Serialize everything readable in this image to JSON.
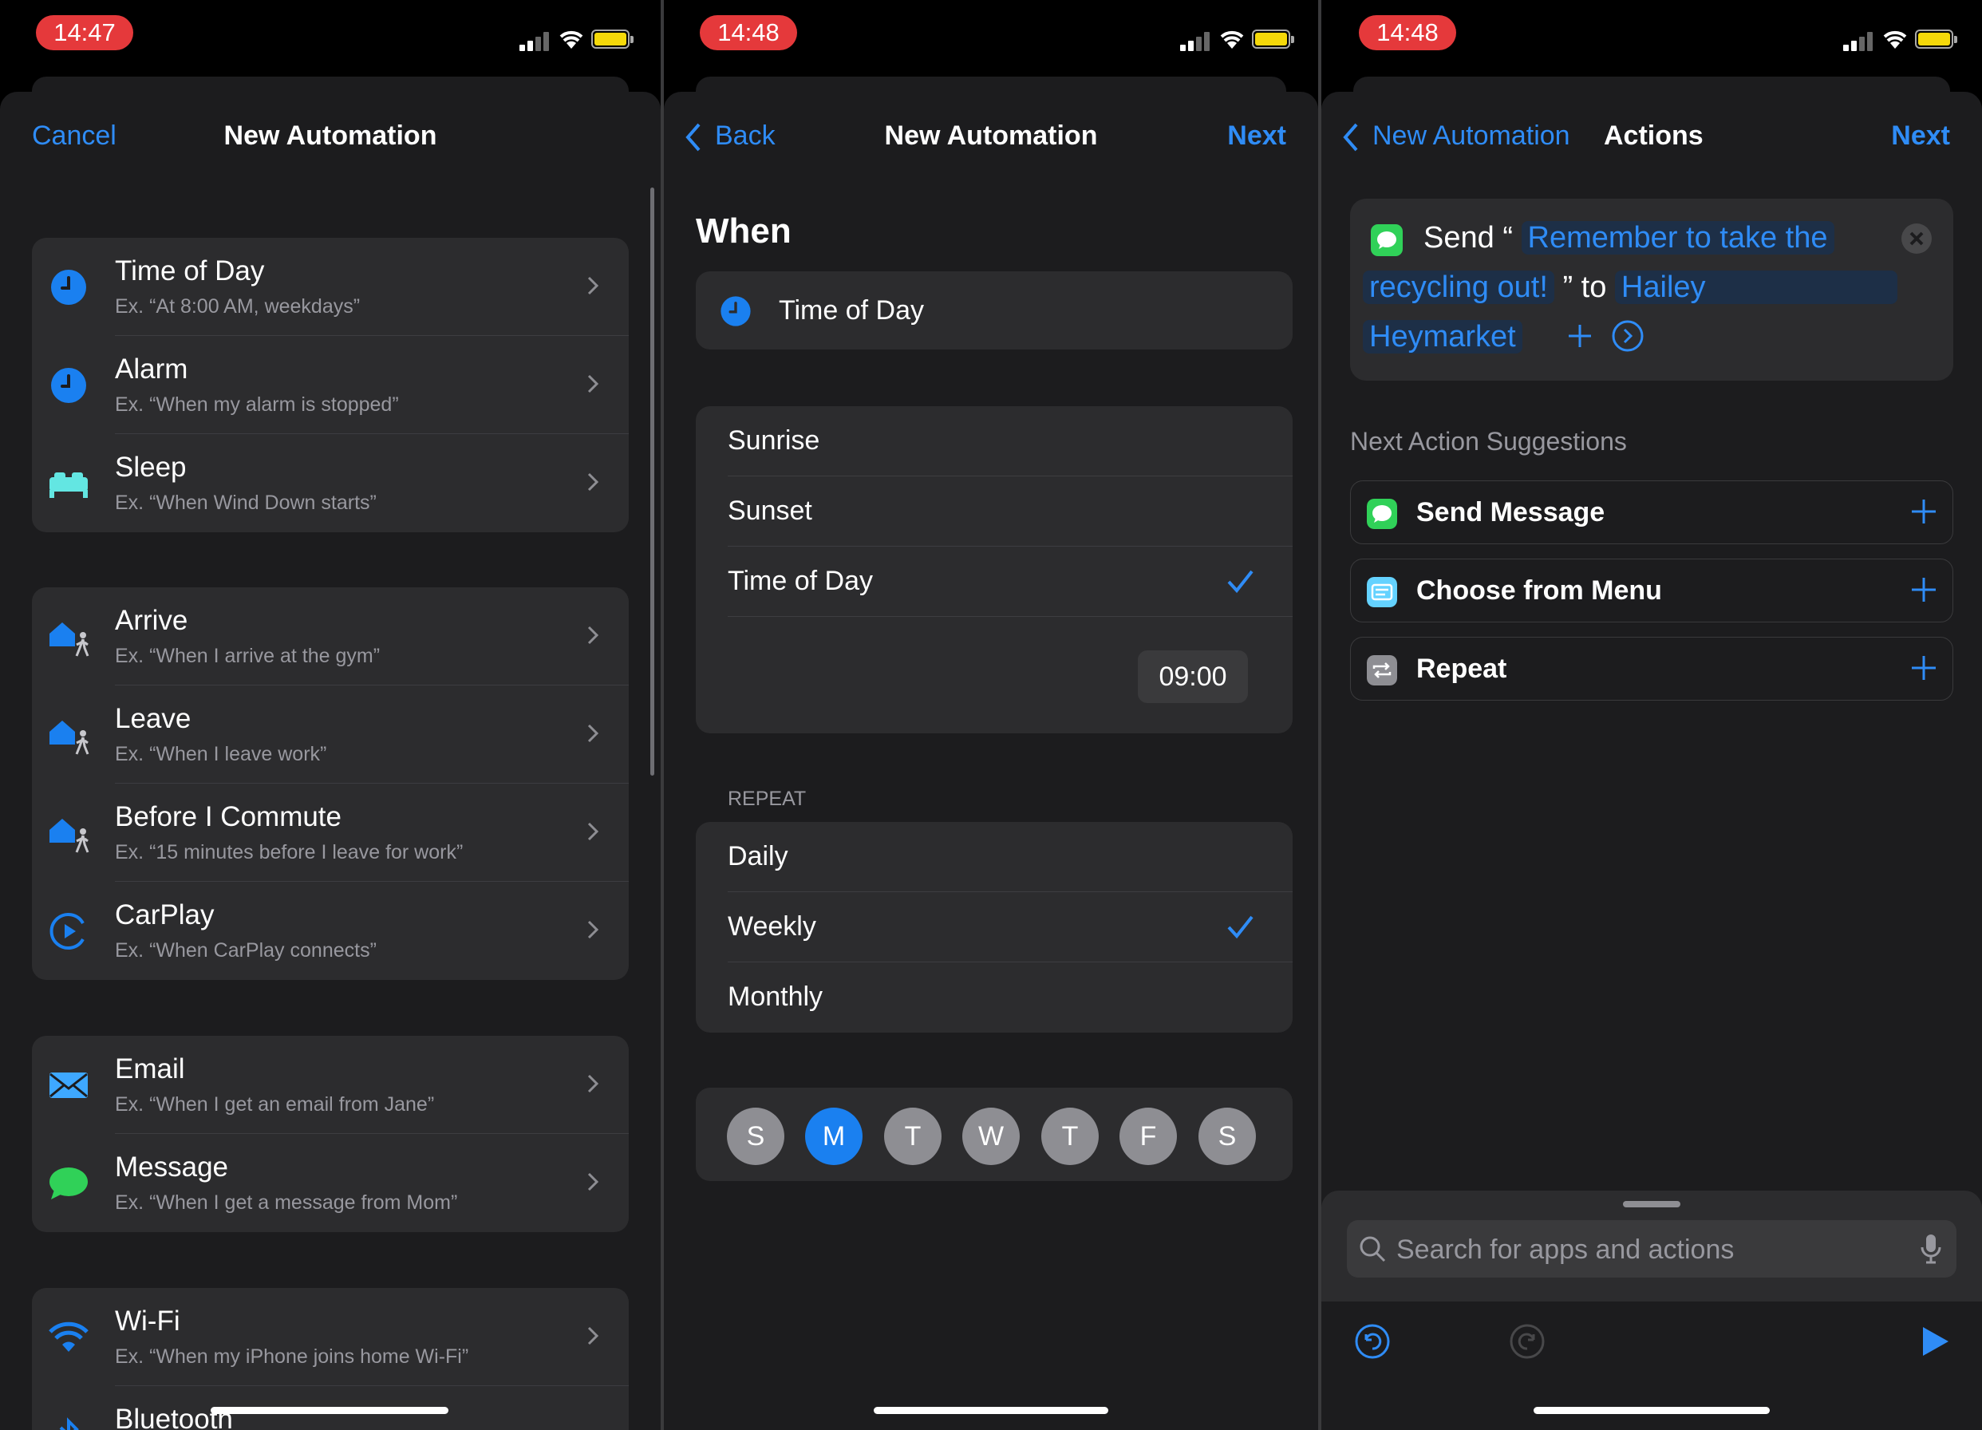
{
  "screen1": {
    "status_time": "14:47",
    "nav": {
      "cancel": "Cancel",
      "title": "New Automation"
    },
    "groups": [
      [
        {
          "title": "Time of Day",
          "subtitle": "Ex. “At 8:00 AM, weekdays”",
          "icon": "clock-icon"
        },
        {
          "title": "Alarm",
          "subtitle": "Ex. “When my alarm is stopped”",
          "icon": "alarm-clock-icon"
        },
        {
          "title": "Sleep",
          "subtitle": "Ex. “When Wind Down starts”",
          "icon": "bed-icon"
        }
      ],
      [
        {
          "title": "Arrive",
          "subtitle": "Ex. “When I arrive at the gym”",
          "icon": "house-person-icon"
        },
        {
          "title": "Leave",
          "subtitle": "Ex. “When I leave work”",
          "icon": "house-person-icon"
        },
        {
          "title": "Before I Commute",
          "subtitle": "Ex. “15 minutes before I leave for work”",
          "icon": "house-person-icon"
        },
        {
          "title": "CarPlay",
          "subtitle": "Ex. “When CarPlay connects”",
          "icon": "carplay-icon"
        }
      ],
      [
        {
          "title": "Email",
          "subtitle": "Ex. “When I get an email from Jane”",
          "icon": "envelope-icon"
        },
        {
          "title": "Message",
          "subtitle": "Ex. “When I get a message from Mom”",
          "icon": "message-bubble-icon"
        }
      ],
      [
        {
          "title": "Wi-Fi",
          "subtitle": "Ex. “When my iPhone joins home Wi-Fi”",
          "icon": "wifi-icon"
        },
        {
          "title": "Bluetooth",
          "subtitle": "",
          "icon": "bluetooth-icon"
        }
      ]
    ]
  },
  "screen2": {
    "status_time": "14:48",
    "nav": {
      "back": "Back",
      "title": "New Automation",
      "next": "Next"
    },
    "when_label": "When",
    "trigger": "Time of Day",
    "options": [
      "Sunrise",
      "Sunset",
      "Time of Day"
    ],
    "selected_option": "Time of Day",
    "time_value": "09:00",
    "repeat_label": "REPEAT",
    "repeat_options": [
      "Daily",
      "Weekly",
      "Monthly"
    ],
    "selected_repeat": "Weekly",
    "days": [
      "S",
      "M",
      "T",
      "W",
      "T",
      "F",
      "S"
    ],
    "selected_day_index": 1
  },
  "screen3": {
    "status_time": "14:48",
    "nav": {
      "back": "New Automation",
      "title": "Actions",
      "next": "Next"
    },
    "action": {
      "verb": "Send",
      "open_quote": "“",
      "message_line1": "Remember to take the",
      "message_line2": "recycling out!",
      "close_quote_to": "” to",
      "recipient_line1": "Hailey",
      "recipient_line2": "Heymarket"
    },
    "suggestions_heading": "Next Action Suggestions",
    "suggestions": [
      {
        "label": "Send Message",
        "icon": "messages-app-icon",
        "color": "#30d158"
      },
      {
        "label": "Choose from Menu",
        "icon": "menu-icon",
        "color": "#64d2ff"
      },
      {
        "label": "Repeat",
        "icon": "repeat-icon",
        "color": "#8e8e93"
      }
    ],
    "search_placeholder": "Search for apps and actions"
  },
  "colors": {
    "accent": "#2f8cf6",
    "time_pill": "#e5393b",
    "battery": "#f5d90a"
  }
}
